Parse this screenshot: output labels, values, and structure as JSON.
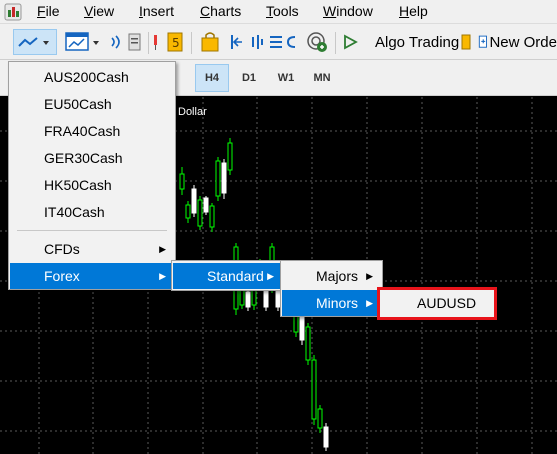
{
  "menubar": {
    "items": [
      {
        "prefix": "",
        "underline": "F",
        "rest": "ile"
      },
      {
        "prefix": "",
        "underline": "V",
        "rest": "iew"
      },
      {
        "prefix": "",
        "underline": "I",
        "rest": "nsert"
      },
      {
        "prefix": "",
        "underline": "C",
        "rest": "harts"
      },
      {
        "prefix": "",
        "underline": "T",
        "rest": "ools"
      },
      {
        "prefix": "",
        "underline": "W",
        "rest": "indow"
      },
      {
        "prefix": "",
        "underline": "H",
        "rest": "elp"
      }
    ]
  },
  "toolbar": {
    "algo_trading_label": "Algo Trading",
    "new_order_label": "New Orde"
  },
  "timeframes": [
    "H4",
    "D1",
    "W1",
    "MN"
  ],
  "active_timeframe": "H4",
  "chart": {
    "label": "Dollar",
    "up_color": "#00ff00",
    "down_color": "#ffffff"
  },
  "symbols_menu": {
    "items": [
      "AUS200Cash",
      "EU50Cash",
      "FRA40Cash",
      "GER30Cash",
      "HK50Cash",
      "IT40Cash"
    ],
    "cfds_label": "CFDs",
    "forex_label": "Forex"
  },
  "forex_submenu": {
    "standard_label": "Standard"
  },
  "standard_submenu": {
    "majors_label": "Majors",
    "minors_label": "Minors"
  },
  "minors_submenu": {
    "audusd_label": "AUDUSD"
  },
  "colors": {
    "menu_highlight": "#0078d7",
    "annotation_red": "#e8141b"
  }
}
